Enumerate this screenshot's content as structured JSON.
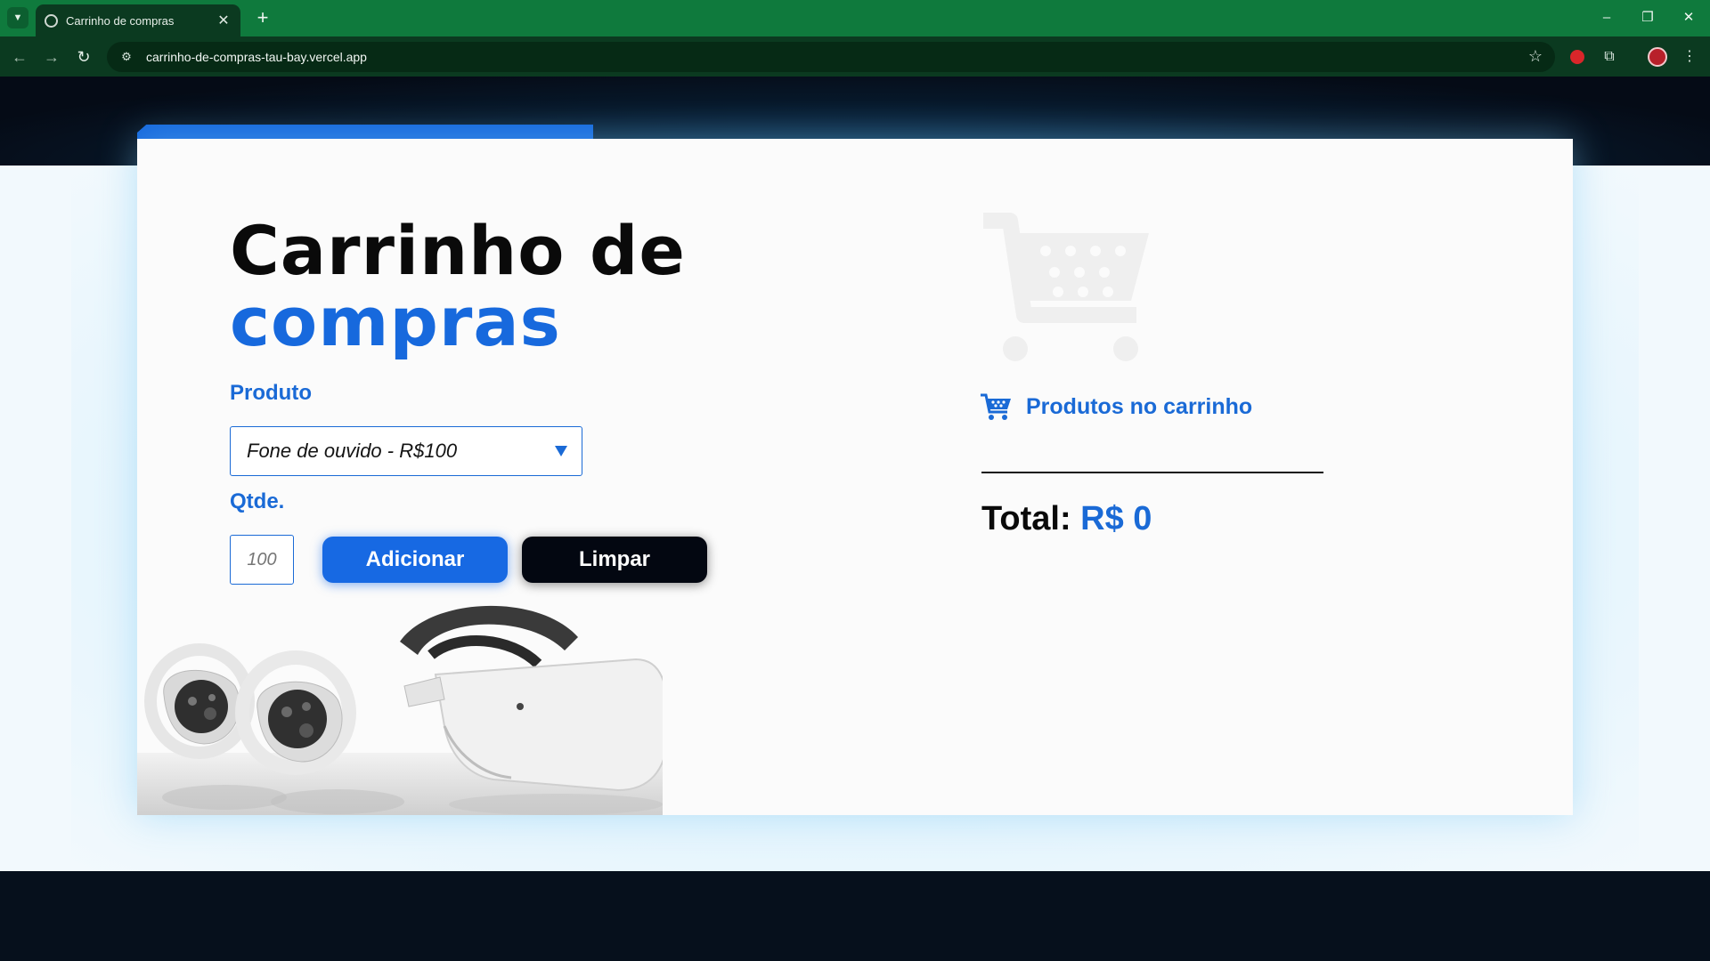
{
  "browser": {
    "tab_title": "Carrinho de compras",
    "url": "carrinho-de-compras-tau-bay.vercel.app",
    "tab_search_icon": "chevron-down-icon",
    "tab_close_icon": "close-icon",
    "new_tab_icon": "plus-icon",
    "window_controls": [
      "minimize-icon",
      "restore-icon",
      "close-icon"
    ],
    "nav_icons": [
      "back-arrow-icon",
      "forward-arrow-icon",
      "reload-icon"
    ],
    "toolbar_icons": [
      "bookmark-star-icon",
      "extension-red-icon",
      "puzzle-extensions-icon",
      "profile-avatar-icon",
      "kebab-menu-icon"
    ]
  },
  "app": {
    "title_line1": "Carrinho de",
    "title_line2": "compras",
    "product_label": "Produto",
    "product_selected": "Fone de ouvido - R$100",
    "qty_label": "Qtde.",
    "qty_placeholder": "100",
    "add_button": "Adicionar",
    "clear_button": "Limpar",
    "cart_heading": "Produtos no carrinho",
    "total_label": "Total:",
    "total_value": "R$ 0"
  },
  "colors": {
    "accent": "#1a6ad6",
    "dark_button": "#030711",
    "browser_frame": "#0f7a3d"
  }
}
